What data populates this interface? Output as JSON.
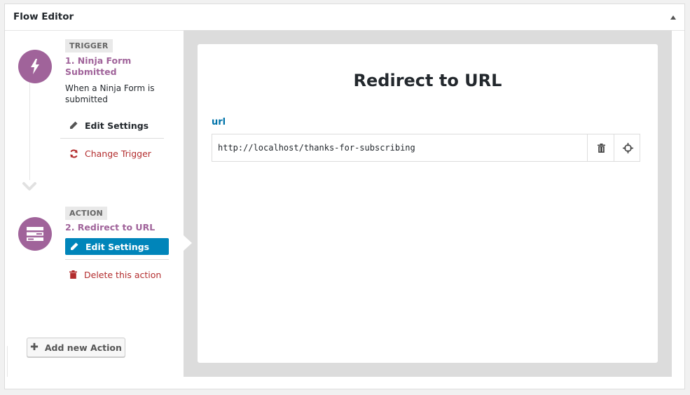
{
  "panel": {
    "title": "Flow Editor",
    "collapse_icon": "triangle-up-icon"
  },
  "trigger": {
    "tag": "TRIGGER",
    "title": "1. Ninja Form Submitted",
    "description": "When a Ninja Form is submitted",
    "icon": "lightning-bolt-icon",
    "edit_label": "Edit Settings",
    "change_label": "Change Trigger"
  },
  "action": {
    "tag": "ACTION",
    "title": "2. Redirect to URL",
    "icon": "server-stack-icon",
    "edit_label": "Edit Settings",
    "delete_label": "Delete this action"
  },
  "add_action_label": "Add new Action",
  "editor": {
    "title": "Redirect to URL",
    "field_label": "url",
    "field_value": "http://localhost/thanks-for-subscribing",
    "delete_icon": "trash-icon",
    "target_icon": "crosshair-icon"
  },
  "colors": {
    "accent_purple": "#a0639a",
    "primary_blue": "#0085ba",
    "link_blue": "#0073aa",
    "danger_red": "#b32d2e"
  }
}
